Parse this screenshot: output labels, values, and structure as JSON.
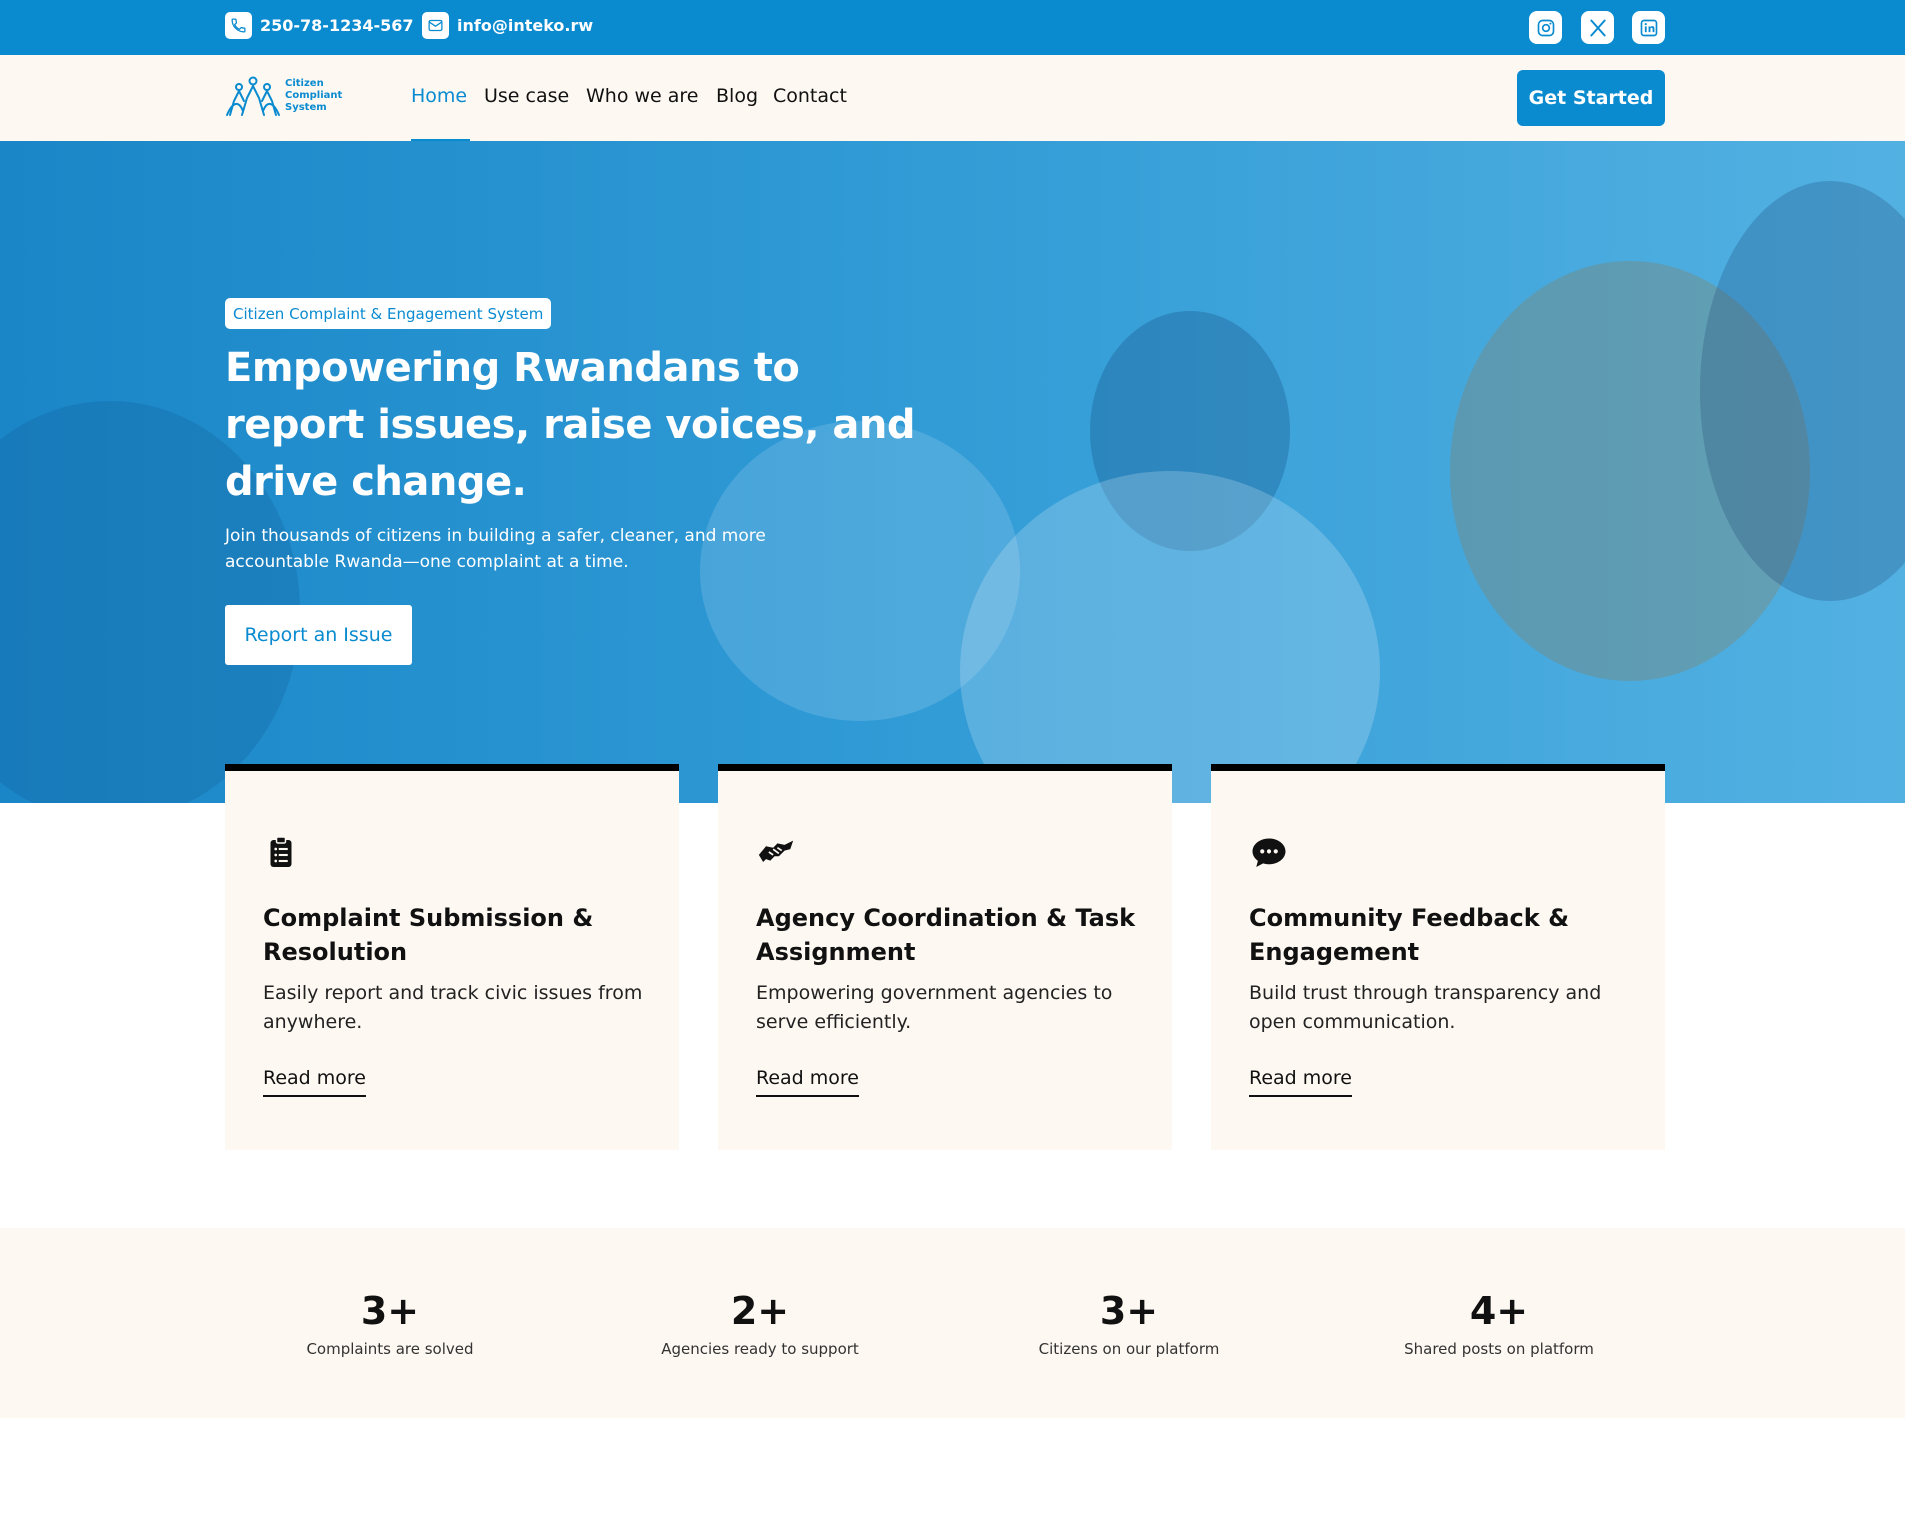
{
  "topbar": {
    "phone": "250-78-1234-567",
    "email": "info@inteko.rw",
    "phone_icon": "phone-icon",
    "email_icon": "mail-icon",
    "socials": [
      "instagram-icon",
      "x-icon",
      "linkedin-icon"
    ]
  },
  "brand": {
    "name_line1": "Citizen",
    "name_line2": "Compliant",
    "name_line3": "System",
    "color": "#0a8bd0"
  },
  "nav": {
    "items": [
      "Home",
      "Use case",
      "Who we are",
      "Blog",
      "Contact"
    ],
    "active": "Home",
    "cta": "Get Started"
  },
  "hero": {
    "badge": "Citizen Complaint & Engagement System",
    "title": "Empowering Rwandans to report issues, raise voices, and drive change.",
    "subtitle": "Join thousands of citizens in building a safer, cleaner, and more accountable Rwanda—one complaint at a time.",
    "button": "Report an Issue"
  },
  "cards": [
    {
      "icon": "clipboard-list-icon",
      "title": "Complaint Submission & Resolution",
      "description": "Easily report and track civic issues from anywhere.",
      "link": "Read more"
    },
    {
      "icon": "handshake-icon",
      "title": "Agency Coordination & Task Assignment",
      "description": "Empowering government agencies to serve efficiently.",
      "link": "Read more"
    },
    {
      "icon": "chat-bubble-icon",
      "title": "Community Feedback & Engagement",
      "description": "Build trust through transparency and open communication.",
      "link": "Read more"
    }
  ],
  "stats": [
    {
      "value": "3+",
      "label": "Complaints are solved"
    },
    {
      "value": "2+",
      "label": "Agencies ready to support"
    },
    {
      "value": "3+",
      "label": "Citizens on our platform"
    },
    {
      "value": "4+",
      "label": "Shared posts on platform"
    }
  ]
}
